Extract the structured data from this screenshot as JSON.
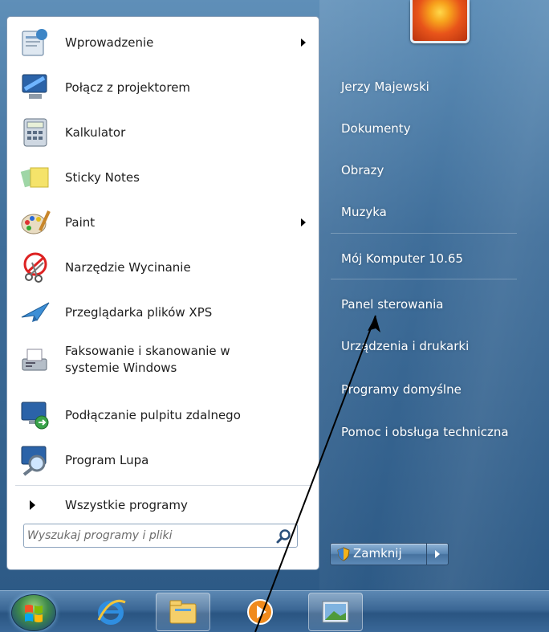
{
  "start_menu": {
    "programs": [
      {
        "label": "Wprowadzenie",
        "icon": "getting-started-icon",
        "has_submenu": true
      },
      {
        "label": "Połącz z projektorem",
        "icon": "projector-icon",
        "has_submenu": false
      },
      {
        "label": "Kalkulator",
        "icon": "calculator-icon",
        "has_submenu": false
      },
      {
        "label": "Sticky Notes",
        "icon": "sticky-notes-icon",
        "has_submenu": false
      },
      {
        "label": "Paint",
        "icon": "paint-icon",
        "has_submenu": true
      },
      {
        "label": "Narzędzie Wycinanie",
        "icon": "snipping-tool-icon",
        "has_submenu": false
      },
      {
        "label": "Przeglądarka plików XPS",
        "icon": "xps-viewer-icon",
        "has_submenu": false
      },
      {
        "label_line1": "Faksowanie i skanowanie w",
        "label_line2": "systemie Windows",
        "icon": "fax-scan-icon",
        "has_submenu": false
      },
      {
        "label": "Podłączanie pulpitu zdalnego",
        "icon": "remote-desktop-icon",
        "has_submenu": false
      },
      {
        "label": "Program Lupa",
        "icon": "magnifier-icon",
        "has_submenu": false
      }
    ],
    "all_programs_label": "Wszystkie programy",
    "search": {
      "placeholder": "Wyszukaj programy i pliki",
      "value": ""
    },
    "right_links": [
      "Jerzy Majewski",
      "Dokumenty",
      "Obrazy",
      "Muzyka",
      "Mój Komputer 10.65",
      "Panel sterowania",
      "Urządzenia i drukarki",
      "Programy domyślne",
      "Pomoc i obsługa techniczna"
    ],
    "shutdown_label": "Zamknij"
  },
  "taskbar": {
    "items": [
      "start-orb",
      "internet-explorer-icon",
      "file-explorer-icon",
      "media-player-icon",
      "picture-viewer-icon"
    ]
  },
  "colors": {
    "glass": "#3f6e9a",
    "link_text": "#ffffff",
    "program_text": "#1e1e1e"
  }
}
